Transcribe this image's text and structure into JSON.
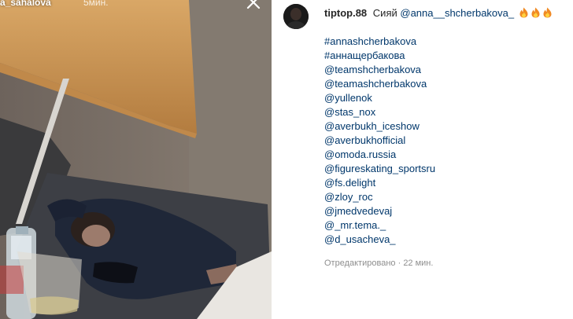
{
  "story": {
    "username": "a_sahalova",
    "time_ago": "5мин."
  },
  "post": {
    "author": "tiptop.88",
    "caption_text": "Сияй",
    "caption_mention": "@anna__shcherbakova_",
    "emoji_icons": [
      "fire-icon",
      "fire-icon",
      "fire-icon"
    ],
    "tags": [
      "#annashcherbakova",
      "#аннащербакова",
      "@teamshcherbakova",
      "@teamashcherbakova",
      "@yullenok",
      "@stas_nox",
      "@averbukh_iceshow",
      "@averbukhofficial",
      "@omoda.russia",
      "@figureskating_sportsru",
      "@fs.delight",
      "@zloy_roc",
      "@jmedvedevaj",
      "@_mr.tema._",
      "@d_usacheva_"
    ],
    "edited_label": "Отредактировано",
    "separator": "·",
    "edited_time": "22 мин."
  },
  "icons": {
    "close": "close-icon",
    "avatar": "avatar"
  },
  "colors": {
    "link": "#00376b",
    "text": "#262626",
    "muted": "#8e8e8e"
  }
}
